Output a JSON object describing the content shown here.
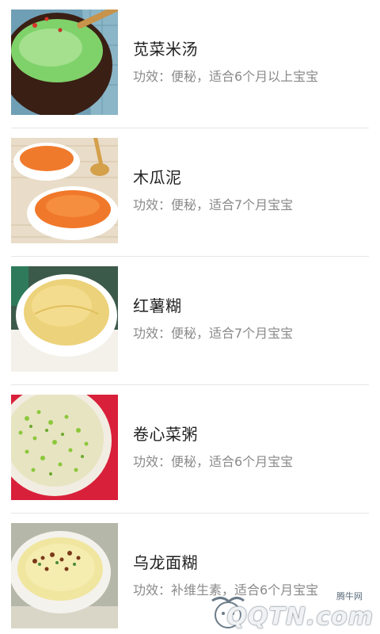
{
  "recipes": [
    {
      "title": "苋菜米汤",
      "effect": "功效：便秘，适合6个月以上宝宝",
      "image": "green-rice-soup"
    },
    {
      "title": "木瓜泥",
      "effect": "功效：便秘，适合7个月宝宝",
      "image": "papaya-puree"
    },
    {
      "title": "红薯糊",
      "effect": "功效：便秘，适合7个月宝宝",
      "image": "sweet-potato-paste"
    },
    {
      "title": "卷心菜粥",
      "effect": "功效：便秘，适合6个月宝宝",
      "image": "cabbage-porridge"
    },
    {
      "title": "乌龙面糊",
      "effect": "功效：补维生素，适合6个月宝宝",
      "image": "noodle-paste"
    }
  ],
  "watermark": {
    "small_text": "腾牛网",
    "brand_text": "QQTN.com"
  }
}
